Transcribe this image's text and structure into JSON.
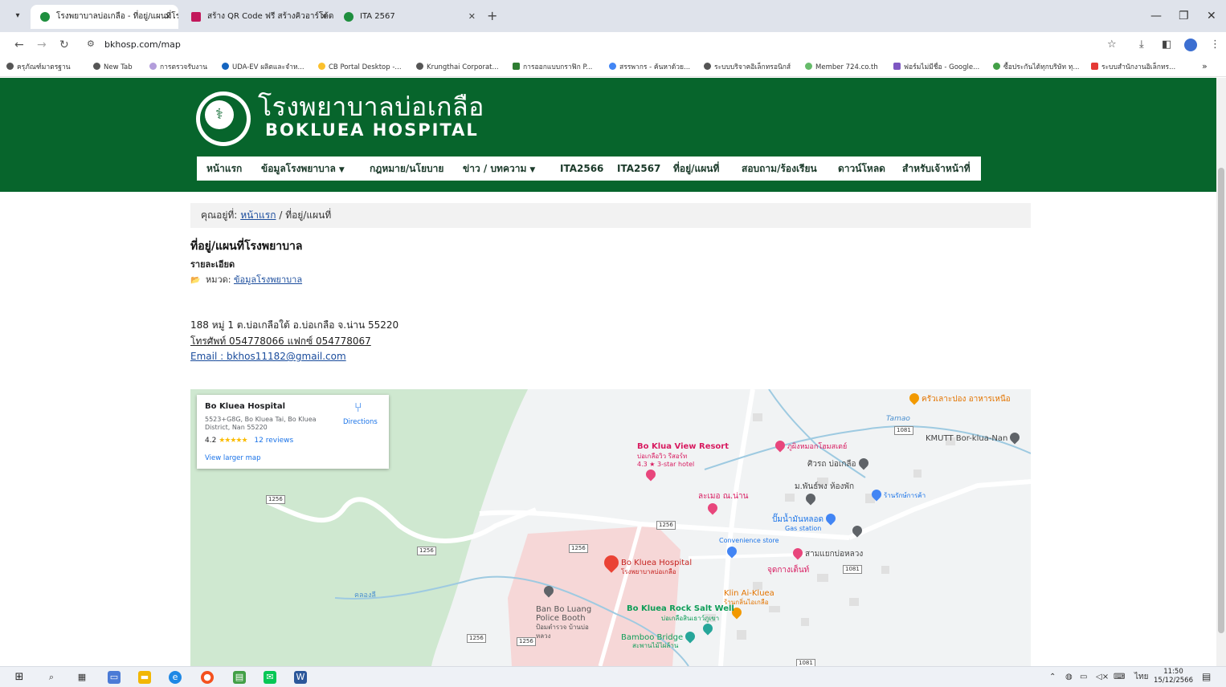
{
  "browser": {
    "tabs": [
      {
        "title": "โรงพยาบาลบ่อเกลือ - ที่อยู่/แผนที่โร",
        "active": true,
        "color": "#1e8e3e"
      },
      {
        "title": "สร้าง QR Code ฟรี สร้างคิวอาร์โค้ด",
        "active": false,
        "color": "#c2185b"
      },
      {
        "title": "ITA 2567",
        "active": false,
        "color": "#1e8e3e"
      }
    ],
    "url": "bkhosp.com/map",
    "bookmarks": [
      "ครุภัณฑ์มาตรฐาน",
      "New Tab",
      "การตรวจรับงาน",
      "UDA-EV ผลิตและจำห...",
      "CB Portal Desktop -...",
      "Krungthai Corporat...",
      "การออกแบบกราฟิก P...",
      "สรรพากร - ค้นหาด้วย...",
      "ระบบบริจาคอิเล็กทรอนิกส์",
      "Member 724.co.th",
      "ฟอร์มไม่มีชื่อ - Google...",
      "ซื้อประกันได้ทุกบริษัท ทุ...",
      "ระบบสำนักงานอิเล็กทร..."
    ],
    "overflow_label": "»"
  },
  "site": {
    "title_th": "โรงพยาบาลบ่อเกลือ",
    "title_en": "BOKLUEA HOSPITAL",
    "nav": [
      {
        "label": "หน้าแรก",
        "dropdown": false
      },
      {
        "label": "ข้อมูลโรงพยาบาล",
        "dropdown": true
      },
      {
        "label": "กฎหมาย/นโยบาย",
        "dropdown": false
      },
      {
        "label": "ข่าว / บทความ",
        "dropdown": true
      },
      {
        "label": "ITA2566",
        "dropdown": false
      },
      {
        "label": "ITA2567",
        "dropdown": false
      },
      {
        "label": "ที่อยู่/แผนที่",
        "dropdown": false
      },
      {
        "label": "สอบถาม/ร้องเรียน",
        "dropdown": false
      },
      {
        "label": "ดาวน์โหลด",
        "dropdown": false
      },
      {
        "label": "สำหรับเจ้าหน้าที่",
        "dropdown": false
      }
    ]
  },
  "breadcrumb": {
    "prefix": "คุณอยู่ที่:",
    "home": "หน้าแรก",
    "separator": "/",
    "current": "ที่อยู่/แผนที่"
  },
  "article": {
    "title": "ที่อยู่/แผนที่โรงพยาบาล",
    "subtitle": "รายละเอียด",
    "category_label": "หมวด:",
    "category": "ข้อมูลโรงพยาบาล",
    "address": "188 หมู่ 1 ต.บ่อเกลือใต้ อ.บ่อเกลือ จ.น่าน 55220",
    "phone": "โทรศัพท์ 054778066   แฟกซ์ 054778067",
    "email": "Email : bkhos11182@gmail.com"
  },
  "map": {
    "card": {
      "name": "Bo Kluea Hospital",
      "address": "5523+G8G, Bo Kluea Tai, Bo Kluea District, Nan 55220",
      "rating": "4.2",
      "stars": "★★★★★",
      "reviews": "12 reviews",
      "directions": "Directions",
      "larger_map": "View larger map"
    },
    "pois": {
      "kmutt": "KMUTT Bor-klua-Nan",
      "restaurant": "ครัวเลาะปอง อาหารเหนือ",
      "resort": "Bo Klua View Resort",
      "resort_th": "บ่อเกลือวิว รีสอร์ท",
      "resort_rating": "4.3 ★ 3-star hotel",
      "home": "ภูผิงหมอกโฮมสเตย์",
      "siwat": "ศิวรถ บ่อเกลือ",
      "mapin": "ม.พันธ์พง ห้องพัก",
      "shop": "ร้านรักษ์การค้า",
      "lamoe": "ละเมอ ณ.น่าน",
      "gas_th": "ปั๊มน้ำมันหลอด",
      "gas_en": "Gas station",
      "convenience": "Convenience store",
      "junction": "สามแยกบ่อหลวง",
      "viewpoint": "จุดกางเต็นท์",
      "hospital": "Bo Kluea Hospital",
      "hospital_th": "โรงพยาบาลบ่อเกลือ",
      "klin": "Klin Ai-Kluea",
      "klin_th": "ร้านกลิ่นไอเกลือ",
      "police": "Ban Bo Luang Police Booth",
      "police_th": "ป้อมตำรวจ บ้านบ่อหลวง",
      "salt": "Bo Kluea Rock Salt Well",
      "salt_th": "บ่อเกลือสินเธาว์ภูเขา",
      "bridge": "Bamboo Bridge",
      "bridge_th": "สะพานไม้ไผ่ล้าน",
      "stream": "คลองลี",
      "tamao": "Tamao"
    },
    "route_labels": [
      "1256",
      "1081"
    ]
  },
  "taskbar": {
    "time": "11:50",
    "date": "15/12/2566",
    "lang": "ไทย"
  }
}
